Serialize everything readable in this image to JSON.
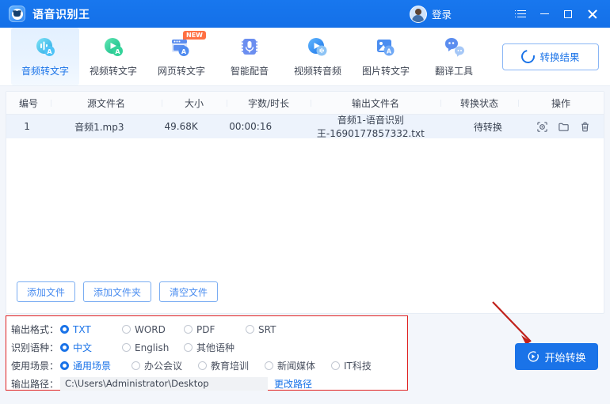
{
  "titlebar": {
    "app_name": "语音识别王",
    "app_icon": "robot-face-icon",
    "login_label": "登录",
    "avatar_icon": "avatar-icon",
    "menu_icon": "list-menu-icon",
    "minimize_icon": "minimize-icon",
    "maximize_icon": "maximize-icon",
    "close_icon": "close-icon",
    "accent": "#1a73e8"
  },
  "toolbar": {
    "items": [
      {
        "label": "音频转文字",
        "icon": "audio-to-text-icon",
        "active": true,
        "badge": ""
      },
      {
        "label": "视频转文字",
        "icon": "video-to-text-icon",
        "active": false,
        "badge": ""
      },
      {
        "label": "网页转文字",
        "icon": "web-to-text-icon",
        "active": false,
        "badge": "NEW"
      },
      {
        "label": "智能配音",
        "icon": "smart-dubbing-icon",
        "active": false,
        "badge": ""
      },
      {
        "label": "视频转音频",
        "icon": "video-to-audio-icon",
        "active": false,
        "badge": ""
      },
      {
        "label": "图片转文字",
        "icon": "image-to-text-icon",
        "active": false,
        "badge": ""
      },
      {
        "label": "翻译工具",
        "icon": "translate-icon",
        "active": false,
        "badge": ""
      }
    ],
    "result_button": {
      "label": "转换结果",
      "icon": "refresh-ring-icon"
    }
  },
  "table": {
    "headers": [
      "编号",
      "源文件名",
      "大小",
      "字数/时长",
      "输出文件名",
      "转换状态",
      "操作"
    ],
    "rows": [
      {
        "index": "1",
        "source_name": "音频1.mp3",
        "size": "49.68K",
        "duration": "00:00:16",
        "output_name": "音频1-语音识别王-1690177857332.txt",
        "status": "待转换",
        "ops": [
          "preview-icon",
          "folder-icon",
          "delete-icon"
        ]
      }
    ]
  },
  "file_actions": [
    {
      "label": "添加文件"
    },
    {
      "label": "添加文件夹"
    },
    {
      "label": "清空文件"
    }
  ],
  "settings": {
    "highlight_color": "#e02020",
    "output_format": {
      "label": "输出格式：",
      "options": [
        {
          "label": "TXT",
          "selected": true
        },
        {
          "label": "WORD",
          "selected": false
        },
        {
          "label": "PDF",
          "selected": false
        },
        {
          "label": "SRT",
          "selected": false
        }
      ]
    },
    "language": {
      "label": "识别语种：",
      "options": [
        {
          "label": "中文",
          "selected": true
        },
        {
          "label": "English",
          "selected": false
        },
        {
          "label": "其他语种",
          "selected": false
        }
      ]
    },
    "scene": {
      "label": "使用场景：",
      "options": [
        {
          "label": "通用场景",
          "selected": true
        },
        {
          "label": "办公会议",
          "selected": false
        },
        {
          "label": "教育培训",
          "selected": false
        },
        {
          "label": "新闻媒体",
          "selected": false
        },
        {
          "label": "IT科技",
          "selected": false
        }
      ]
    },
    "output_path": {
      "label": "输出路径：",
      "value": "C:\\Users\\Administrator\\Desktop",
      "placeholder": "C:\\Users\\Administrator\\Desktop",
      "change_link": "更改路径"
    }
  },
  "start": {
    "label": "开始转换",
    "icon": "play-circle-icon",
    "annotation_arrow": "red-arrow-pointing-to-start-button",
    "arrow_color": "#c0201a"
  }
}
